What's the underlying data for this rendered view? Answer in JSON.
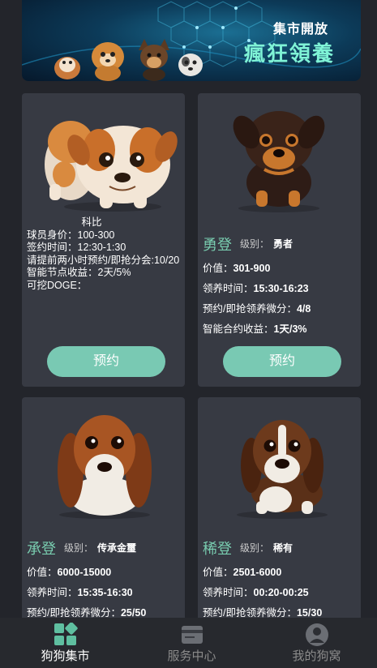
{
  "banner": {
    "tag": "集市開放",
    "slogan": "瘋狂領養"
  },
  "cards": [
    {
      "type": "simple",
      "title": "科比",
      "lines": [
        "球员身价：100-300",
        "签约时间：12:30-1:30",
        "请提前两小时预约/即抢分会:10/20",
        "智能节点收益：2天/5%",
        "可挖DOGE："
      ],
      "button": "预约",
      "colors": {
        "coat": "#d98a3f",
        "patch": "#f3e6d6"
      }
    },
    {
      "type": "detail",
      "name": "勇登",
      "level_label": "级别：",
      "level": "勇者",
      "rows": [
        {
          "label": "价值：",
          "value": "301-900"
        },
        {
          "label": "领养时间：",
          "value": "15:30-16:23"
        },
        {
          "label": "预约/即抢领养微分：",
          "value": "4/8"
        },
        {
          "label": "智能合约收益：",
          "value": "1天/3%"
        }
      ],
      "button": "预约"
    },
    {
      "type": "detail",
      "name": "承登",
      "level_label": "级别：",
      "level": "传承金璽",
      "rows": [
        {
          "label": "价值：",
          "value": "6000-15000"
        },
        {
          "label": "领养时间：",
          "value": "15:35-16:30"
        },
        {
          "label": "预约/即抢领养微分：",
          "value": "25/50"
        }
      ]
    },
    {
      "type": "detail",
      "name": "稀登",
      "level_label": "级别：",
      "level": "稀有",
      "rows": [
        {
          "label": "价值：",
          "value": "2501-6000"
        },
        {
          "label": "领养时间：",
          "value": "00:20-00:25"
        },
        {
          "label": "预约/即抢领养微分：",
          "value": "15/30"
        }
      ]
    }
  ],
  "nav": [
    {
      "label": "狗狗集市",
      "icon": "market-grid-icon",
      "active": true
    },
    {
      "label": "服务中心",
      "icon": "card-icon",
      "active": false
    },
    {
      "label": "我的狗窝",
      "icon": "user-icon",
      "active": false
    }
  ],
  "colors": {
    "accent": "#79c9b3",
    "card": "#373a43",
    "background": "#23252b"
  }
}
